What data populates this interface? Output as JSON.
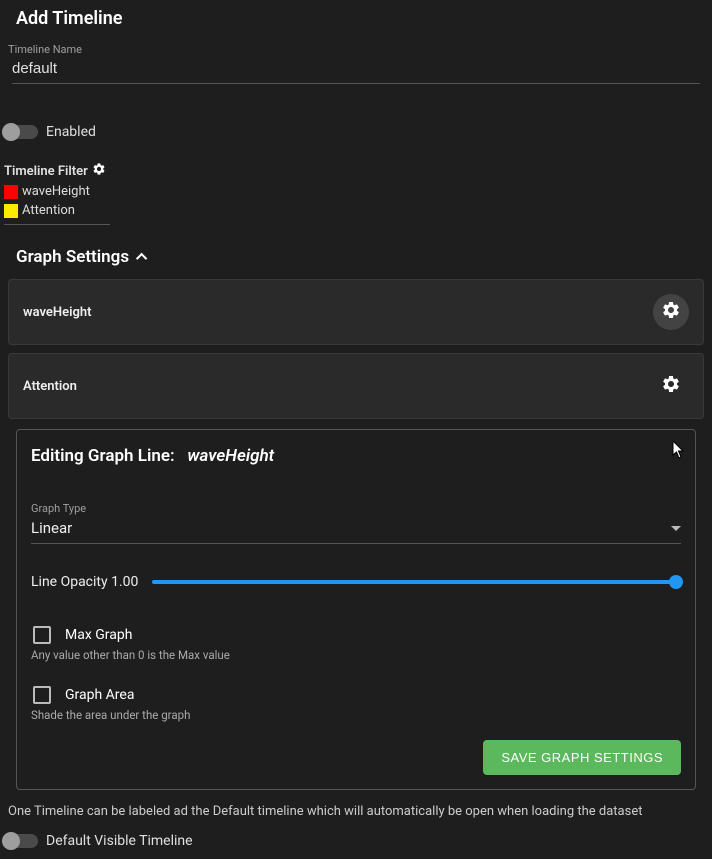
{
  "title": "Add Timeline",
  "timelineName": {
    "label": "Timeline Name",
    "value": "default"
  },
  "enabled": {
    "label": "Enabled",
    "value": false
  },
  "filter": {
    "header": "Timeline Filter",
    "items": [
      {
        "name": "waveHeight",
        "color": "#ff0000"
      },
      {
        "name": "Attention",
        "color": "#ffeb00"
      }
    ]
  },
  "graphSettings": {
    "header": "Graph Settings",
    "expanded": true,
    "lines": [
      {
        "name": "waveHeight",
        "active": true
      },
      {
        "name": "Attention",
        "active": false
      }
    ]
  },
  "editing": {
    "label": "Editing Graph Line:",
    "lineName": "waveHeight",
    "graphType": {
      "label": "Graph Type",
      "value": "Linear"
    },
    "lineOpacity": {
      "label": "Line Opacity",
      "value": "1.00"
    },
    "maxGraph": {
      "label": "Max Graph",
      "checked": false,
      "helper": "Any value other than 0 is the Max value"
    },
    "graphArea": {
      "label": "Graph Area",
      "checked": false,
      "helper": "Shade the area under the graph"
    },
    "saveButton": "Save Graph Settings"
  },
  "infoText": "One Timeline can be labeled ad the Default timeline which will automatically be open when loading the dataset",
  "defaultVisible": {
    "label": "Default Visible Timeline",
    "value": false
  }
}
